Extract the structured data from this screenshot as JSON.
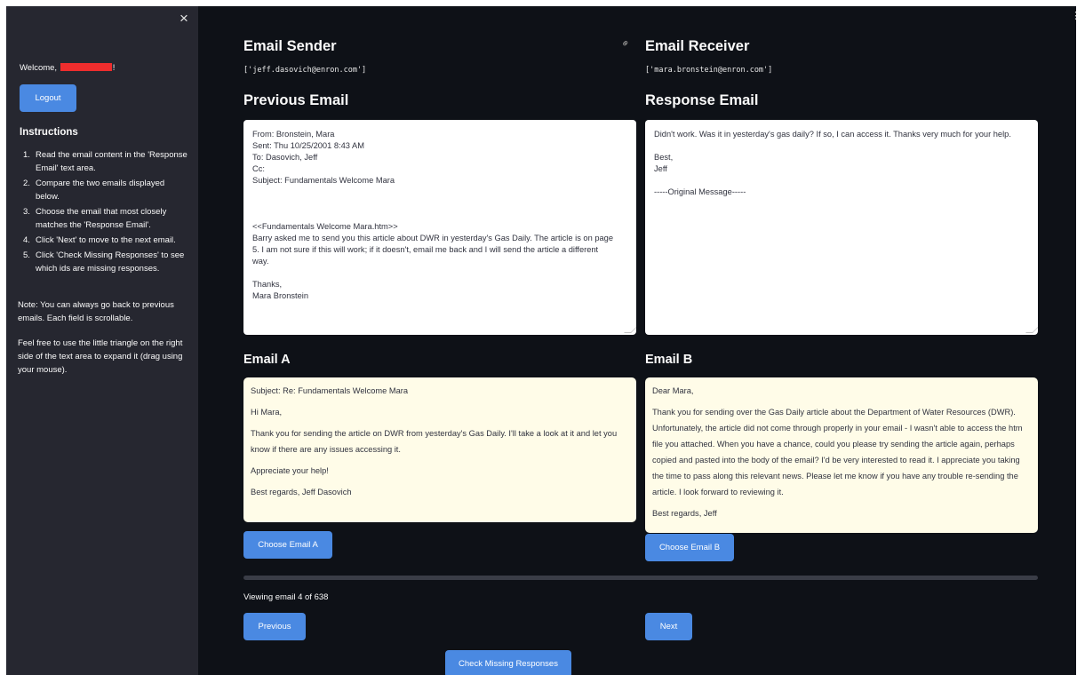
{
  "sidebar": {
    "close_glyph": "×",
    "welcome_prefix": "Welcome,",
    "welcome_suffix": "!",
    "logout_label": "Logout",
    "instructions_title": "Instructions",
    "instructions": [
      "Read the email content in the 'Response Email' text area.",
      "Compare the two emails displayed below.",
      "Choose the email that most closely matches the 'Response Email'.",
      "Click 'Next' to move to the next email.",
      "Click 'Check Missing Responses' to see which ids are missing responses."
    ],
    "note": "Note: You can always go back to previous emails. Each field is scrollable.",
    "tip": "Feel free to use the little triangle on the right side of the text area to expand it (drag using your mouse)."
  },
  "sender": {
    "title": "Email Sender",
    "value": "['jeff.dasovich@enron.com']"
  },
  "receiver": {
    "title": "Email Receiver",
    "value": "['mara.bronstein@enron.com']"
  },
  "previous_email": {
    "title": "Previous Email",
    "lines": [
      "From: Bronstein, Mara",
      "Sent: Thu 10/25/2001 8:43 AM",
      "To: Dasovich, Jeff",
      "Cc:",
      "Subject: Fundamentals Welcome Mara",
      "",
      "",
      "",
      "<<Fundamentals Welcome Mara.htm>>",
      "Barry asked me to send you this article about DWR in yesterday's Gas Daily.  The article is on page",
      "5.  I am not sure if this will work;  if it doesn't, email me back and I will send the article a different",
      "way.",
      "",
      "Thanks,",
      "Mara Bronstein"
    ]
  },
  "response_email": {
    "title": "Response Email",
    "lines": [
      "Didn't work.  Was it in yesterday's gas daily?  If so, I can access it.  Thanks very much for your help.",
      "",
      "Best,",
      "Jeff",
      "",
      "-----Original Message-----"
    ]
  },
  "email_a": {
    "title": "Email A",
    "paragraphs": [
      "Subject: Re: Fundamentals Welcome Mara",
      "Hi Mara,",
      "Thank you for sending the article on DWR from yesterday's Gas Daily. I'll take a look at it and let you know if there are any issues accessing it.",
      "Appreciate your help!",
      "Best regards, Jeff Dasovich"
    ],
    "choose_label": "Choose Email A"
  },
  "email_b": {
    "title": "Email B",
    "paragraphs": [
      "Dear Mara,",
      "Thank you for sending over the Gas Daily article about the Department of Water Resources (DWR). Unfortunately, the article did not come through properly in your email - I wasn't able to access the htm file you attached. When you have a chance, could you please try sending the article again, perhaps copied and pasted into the body of the email? I'd be very interested to read it. I appreciate you taking the time to pass along this relevant news. Please let me know if you have any trouble re-sending the article. I look forward to reviewing it.",
      "Best regards, Jeff"
    ],
    "choose_label": "Choose Email B"
  },
  "nav": {
    "viewing_text": "Viewing email 4 of 638",
    "previous_label": "Previous",
    "next_label": "Next",
    "check_missing_label": "Check Missing Responses"
  },
  "icons": {
    "close": "close-icon",
    "link": "link-icon",
    "menu": "more-vertical-icon"
  },
  "colors": {
    "app_bg": "#0e1117",
    "sidebar_bg": "#262730",
    "button": "#4a89e2",
    "card_bg": "#fffce8",
    "redaction": "#ee2d2d"
  }
}
